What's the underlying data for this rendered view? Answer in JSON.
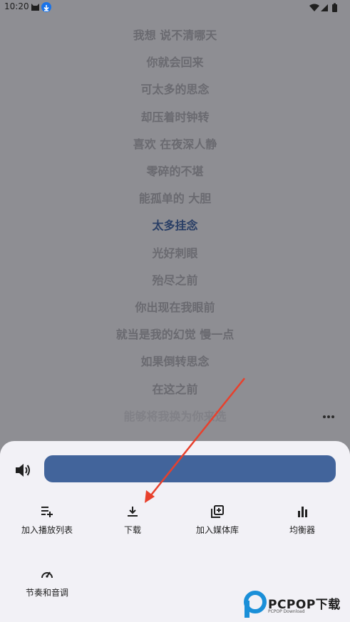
{
  "status_bar": {
    "time": "10:20",
    "icons": [
      "cat-icon",
      "download-notification-icon",
      "wifi-icon",
      "signal-icon",
      "battery-icon"
    ]
  },
  "lyrics": {
    "lines": [
      {
        "text": "我想 说不清哪天"
      },
      {
        "text": "你就会回来"
      },
      {
        "text": "可太多的思念"
      },
      {
        "text": "却压着时钟转"
      },
      {
        "text": "喜欢 在夜深人静"
      },
      {
        "text": "零碎的不堪"
      },
      {
        "text": "能孤单的 大胆"
      },
      {
        "text": "太多挂念",
        "active": true
      },
      {
        "text": "光好刺眼"
      },
      {
        "text": "殆尽之前"
      },
      {
        "text": "你出现在我眼前"
      },
      {
        "text": "就当是我的幻觉 慢一点"
      },
      {
        "text": "如果倒转思念"
      },
      {
        "text": "在这之前"
      },
      {
        "text": "能够将我换为你来选",
        "faded": true
      }
    ]
  },
  "bottom_sheet": {
    "volume_percent": 100,
    "actions": [
      {
        "label": "加入播放列表",
        "icon": "playlist-add-icon"
      },
      {
        "label": "下载",
        "icon": "download-icon"
      },
      {
        "label": "加入媒体库",
        "icon": "library-add-icon"
      },
      {
        "label": "均衡器",
        "icon": "equalizer-icon"
      },
      {
        "label": "节奏和音调",
        "icon": "speed-icon"
      }
    ]
  },
  "watermark": {
    "brand": "PCPOP下载",
    "sub": "PCPOP Download"
  },
  "colors": {
    "overlay": "#8e8e93",
    "sheet": "#f2f1f6",
    "slider": "#42649b",
    "active_lyric": "#2a3f66",
    "annotation_arrow": "#e8402c"
  }
}
